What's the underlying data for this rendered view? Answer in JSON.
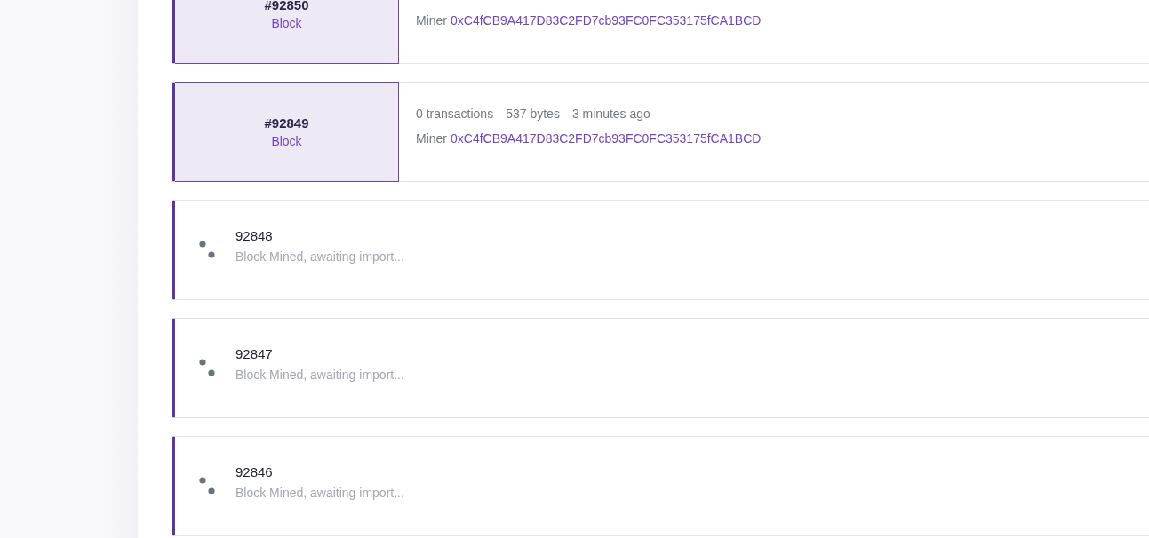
{
  "blocks": [
    {
      "kind": "imported",
      "number": "#92850",
      "label": "Block",
      "miner_label": "Miner",
      "miner": "0xC4fCB9A417D83C2FD7cb93FC0FC353175fCA1BCD"
    },
    {
      "kind": "imported",
      "number": "#92849",
      "label": "Block",
      "stats": [
        "0 transactions",
        "537 bytes",
        "3 minutes ago"
      ],
      "miner_label": "Miner",
      "miner": "0xC4fCB9A417D83C2FD7cb93FC0FC353175fCA1BCD"
    },
    {
      "kind": "pending",
      "number": "92848",
      "status": "Block Mined, awaiting import..."
    },
    {
      "kind": "pending",
      "number": "92847",
      "status": "Block Mined, awaiting import..."
    },
    {
      "kind": "pending",
      "number": "92846",
      "status": "Block Mined, awaiting import..."
    }
  ]
}
